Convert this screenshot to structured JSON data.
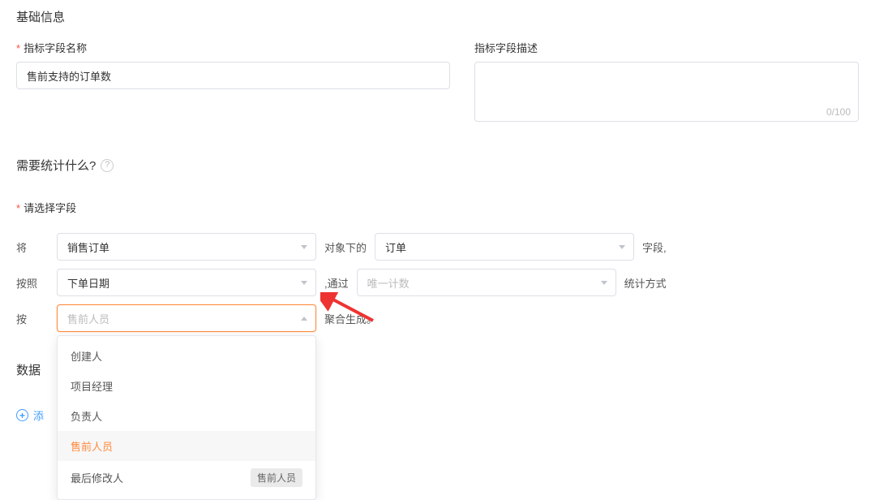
{
  "basic": {
    "section_title": "基础信息",
    "name_label": "指标字段名称",
    "name_value": "售前支持的订单数",
    "desc_label": "指标字段描述",
    "desc_value": "",
    "char_count": "0/100"
  },
  "stats": {
    "section_title": "需要统计什么?",
    "select_field_label": "请选择字段",
    "line1": {
      "prefix": "将",
      "object_value": "销售订单",
      "mid": "对象下的",
      "field_value": "订单",
      "suffix": "字段,"
    },
    "line2": {
      "prefix": "按照",
      "date_value": "下单日期",
      "mid": ",通过",
      "method_placeholder": "唯一计数",
      "suffix": "统计方式"
    },
    "line3": {
      "prefix": "按",
      "group_placeholder": "售前人员",
      "suffix": "聚合生成。"
    },
    "dropdown": {
      "items": [
        {
          "label": "创建人",
          "selected": false
        },
        {
          "label": "项目经理",
          "selected": false
        },
        {
          "label": "负责人",
          "selected": false
        },
        {
          "label": "售前人员",
          "selected": true
        },
        {
          "label": "最后修改人",
          "selected": false,
          "badge": "售前人员"
        }
      ]
    }
  },
  "data_section": {
    "title_truncated": "数据",
    "add_filter_truncated": "添"
  }
}
